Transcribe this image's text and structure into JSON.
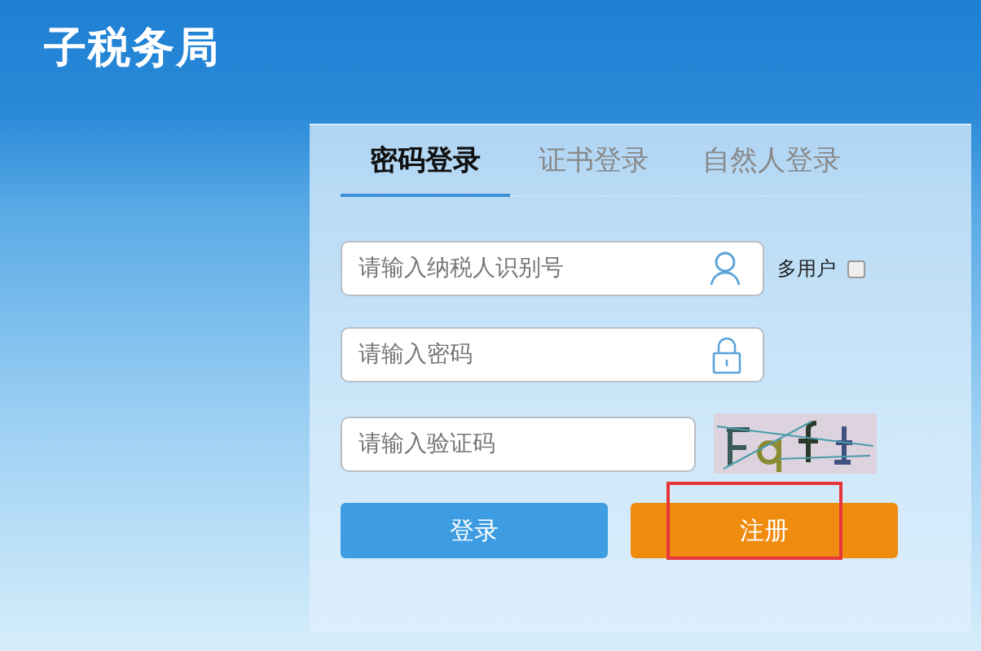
{
  "header": {
    "title": "子税务局"
  },
  "login_panel": {
    "tabs": [
      {
        "label": "密码登录",
        "selected": true
      },
      {
        "label": "证书登录",
        "selected": false
      },
      {
        "label": "自然人登录",
        "selected": false
      }
    ],
    "fields": [
      {
        "kind": "user",
        "placeholder": "请输入纳税人识别号"
      },
      {
        "kind": "lock",
        "placeholder": "请输入密码"
      },
      {
        "kind": "captcha",
        "placeholder": "请输入验证码"
      }
    ],
    "multi_user": {
      "label": "多用户",
      "checked": false
    },
    "buttons": [
      {
        "kind": "primary",
        "label": "登录",
        "highlighted": false
      },
      {
        "kind": "secondary",
        "label": "注册",
        "highlighted": true
      }
    ]
  }
}
